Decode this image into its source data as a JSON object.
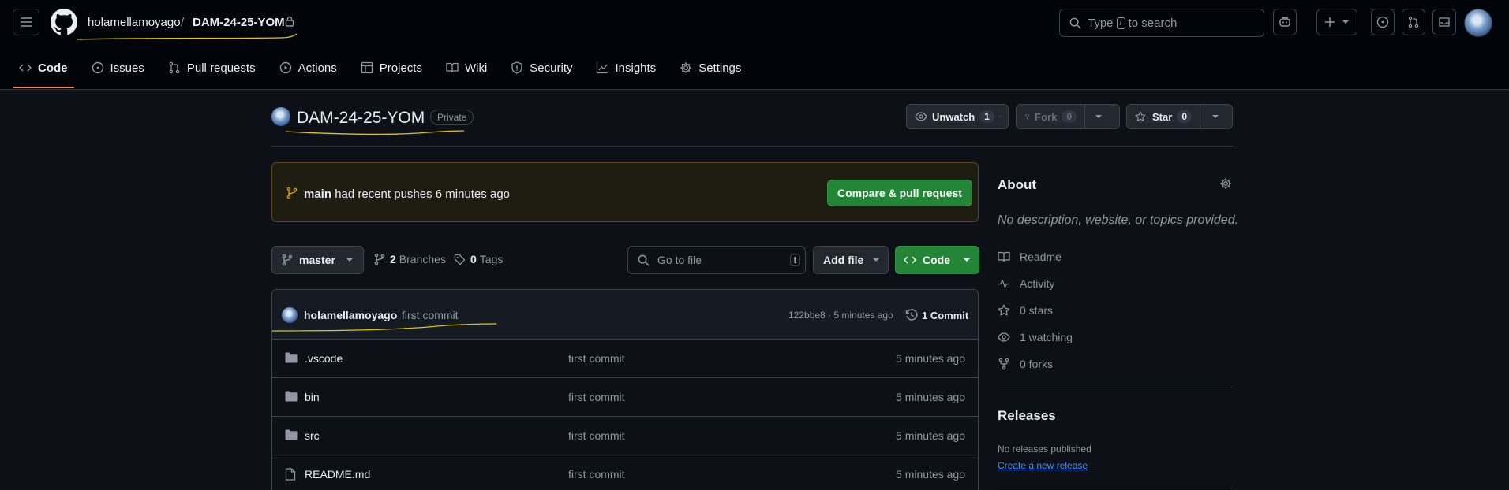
{
  "header": {
    "owner": "holamellamoyago",
    "separator": "/",
    "repo": "DAM-24-25-YOM",
    "search_prefix": "Type",
    "search_key": "/",
    "search_suffix": "to search"
  },
  "tabs": [
    {
      "label": "Code",
      "icon": "code-icon",
      "active": true
    },
    {
      "label": "Issues",
      "icon": "issue-icon"
    },
    {
      "label": "Pull requests",
      "icon": "pull-request-icon"
    },
    {
      "label": "Actions",
      "icon": "play-icon"
    },
    {
      "label": "Projects",
      "icon": "table-icon"
    },
    {
      "label": "Wiki",
      "icon": "book-icon"
    },
    {
      "label": "Security",
      "icon": "shield-icon"
    },
    {
      "label": "Insights",
      "icon": "graph-icon"
    },
    {
      "label": "Settings",
      "icon": "gear-icon"
    }
  ],
  "repo": {
    "title": "DAM-24-25-YOM",
    "visibility": "Private",
    "unwatch_label": "Unwatch",
    "unwatch_count": "1",
    "fork_label": "Fork",
    "fork_count": "0",
    "star_label": "Star",
    "star_count": "0"
  },
  "banner": {
    "branch": "main",
    "text": "had recent pushes 6 minutes ago",
    "button": "Compare & pull request"
  },
  "filenav": {
    "branch": "master",
    "branches_count": "2",
    "branches_label": "Branches",
    "tags_count": "0",
    "tags_label": "Tags",
    "goto_placeholder": "Go to file",
    "goto_key": "t",
    "add_file": "Add file",
    "code": "Code"
  },
  "commit": {
    "author": "holamellamoyago",
    "message": "first commit",
    "sha_time": "122bbe8 · 5 minutes ago",
    "count_label": "1 Commit"
  },
  "files": [
    {
      "name": ".vscode",
      "type": "folder",
      "commit": "first commit",
      "time": "5 minutes ago"
    },
    {
      "name": "bin",
      "type": "folder",
      "commit": "first commit",
      "time": "5 minutes ago"
    },
    {
      "name": "src",
      "type": "folder",
      "commit": "first commit",
      "time": "5 minutes ago"
    },
    {
      "name": "README.md",
      "type": "file",
      "commit": "first commit",
      "time": "5 minutes ago"
    }
  ],
  "about": {
    "title": "About",
    "description": "No description, website, or topics provided.",
    "items": [
      {
        "label": "Readme",
        "icon": "book-icon"
      },
      {
        "label": "Activity",
        "icon": "pulse-icon"
      },
      {
        "label": "0 stars",
        "icon": "star-icon"
      },
      {
        "label": "1 watching",
        "icon": "eye-icon"
      },
      {
        "label": "0 forks",
        "icon": "fork-icon"
      }
    ]
  },
  "releases": {
    "title": "Releases",
    "none": "No releases published",
    "create": "Create a new release"
  },
  "colors": {
    "background": "#0d1117",
    "header": "#010409",
    "accent_green": "#238636",
    "link": "#4493f8",
    "annotation": "#e3c800"
  }
}
